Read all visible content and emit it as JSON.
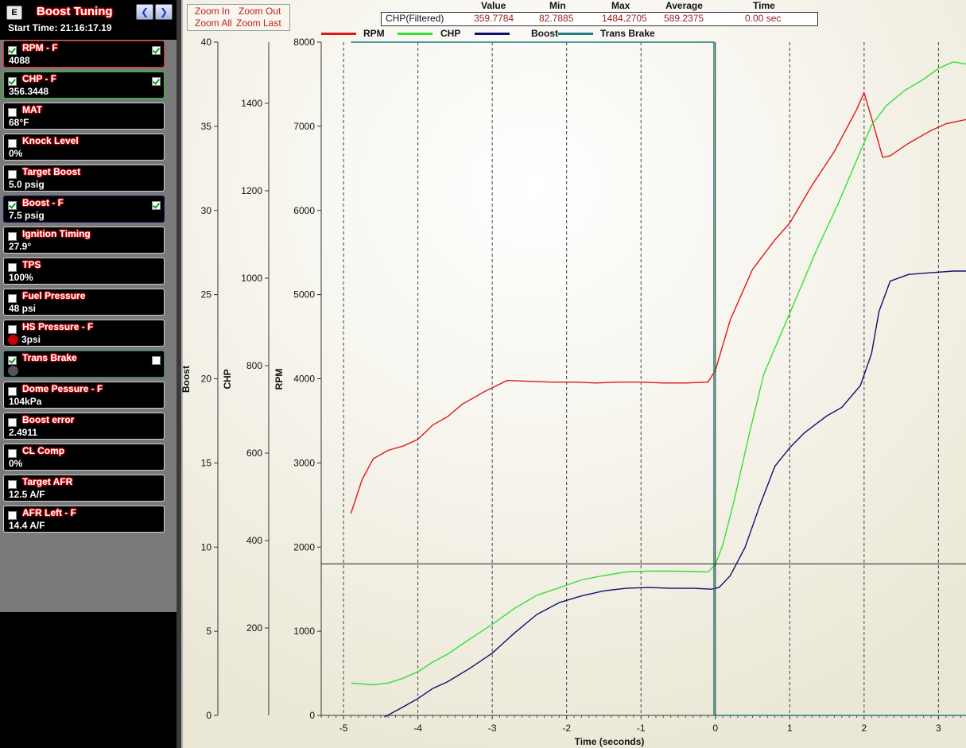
{
  "app": {
    "title": "Boost Tuning",
    "menu_label": "E",
    "start_time": "Start Time: 21:16:17.19",
    "nav_left": "❮",
    "nav_right": "❯"
  },
  "channels": [
    {
      "name": "RPM - F",
      "value": "4088",
      "checked": true,
      "right_check": true,
      "border": "#e02020"
    },
    {
      "name": "CHP - F",
      "value": "356.3448",
      "checked": true,
      "right_check": true,
      "border": "#20d020"
    },
    {
      "name": "MAT",
      "value": "68°F",
      "checked": false
    },
    {
      "name": "Knock Level",
      "value": "0%",
      "checked": false
    },
    {
      "name": "Target Boost",
      "value": "5.0 psig",
      "checked": false
    },
    {
      "name": "Boost - F",
      "value": "7.5 psig",
      "checked": true,
      "right_check": true,
      "border": "#10107a"
    },
    {
      "name": "Ignition Timing",
      "value": "27.9°",
      "checked": false
    },
    {
      "name": "TPS",
      "value": "100%",
      "checked": false
    },
    {
      "name": "Fuel Pressure",
      "value": "48 psi",
      "checked": false
    },
    {
      "name": "HS Pressure - F",
      "value": "3psi",
      "checked": false,
      "led": "#c00000"
    },
    {
      "name": "Trans Brake",
      "value": "",
      "checked": true,
      "right_check": false,
      "border": "#1a8080",
      "led": "#555555"
    },
    {
      "name": "Dome Pessure - F",
      "value": "104kPa",
      "checked": false
    },
    {
      "name": "Boost error",
      "value": "2.4911",
      "checked": false
    },
    {
      "name": "CL Comp",
      "value": "0%",
      "checked": false
    },
    {
      "name": "Target AFR",
      "value": "12.5 A/F",
      "checked": false
    },
    {
      "name": "AFR Left - F",
      "value": "14.4 A/F",
      "checked": false
    }
  ],
  "zoom": {
    "in": "Zoom In",
    "out": "Zoom Out",
    "all": "Zoom All",
    "last": "Zoom Last"
  },
  "stats": {
    "headers": {
      "value": "Value",
      "min": "Min",
      "max": "Max",
      "average": "Average",
      "time": "Time"
    },
    "channel": "CHP(Filtered)",
    "value": "359.7784",
    "min": "82.7885",
    "max": "1484.2705",
    "average": "589.2375",
    "time": "0.00 sec"
  },
  "chart_data": {
    "type": "line",
    "xlabel": "Time (seconds)",
    "xlim": [
      -5.3,
      3.37
    ],
    "x_ticks": [
      "-5",
      "-4",
      "-3",
      "-2",
      "-1",
      "0",
      "1",
      "2",
      "3"
    ],
    "grid": "vertical dashed at whole seconds",
    "legend": "top",
    "cursor": {
      "x": 0,
      "y_rpm": 1800
    },
    "axes": [
      {
        "label": "Boost",
        "ylim": [
          0,
          40
        ],
        "ticks": [
          "0",
          "5",
          "10",
          "15",
          "20",
          "25",
          "30",
          "35",
          "40"
        ]
      },
      {
        "label": "CHP",
        "ylim": [
          0,
          1540
        ],
        "ticks": [
          "200",
          "400",
          "600",
          "800",
          "1000",
          "1200",
          "1400"
        ]
      },
      {
        "label": "RPM",
        "ylim": [
          0,
          8000
        ],
        "ticks": [
          "0",
          "1000",
          "2000",
          "3000",
          "4000",
          "5000",
          "6000",
          "7000",
          "8000"
        ]
      }
    ],
    "series": [
      {
        "name": "RPM",
        "axis": "RPM",
        "color": "#e01818",
        "points": [
          [
            -4.9,
            2400
          ],
          [
            -4.75,
            2800
          ],
          [
            -4.6,
            3050
          ],
          [
            -4.4,
            3150
          ],
          [
            -4.2,
            3200
          ],
          [
            -4.0,
            3280
          ],
          [
            -3.8,
            3450
          ],
          [
            -3.6,
            3550
          ],
          [
            -3.4,
            3700
          ],
          [
            -3.1,
            3850
          ],
          [
            -2.8,
            3980
          ],
          [
            -2.5,
            3970
          ],
          [
            -2.2,
            3960
          ],
          [
            -1.9,
            3960
          ],
          [
            -1.6,
            3950
          ],
          [
            -1.3,
            3960
          ],
          [
            -1.0,
            3960
          ],
          [
            -0.7,
            3950
          ],
          [
            -0.4,
            3950
          ],
          [
            -0.1,
            3960
          ],
          [
            0,
            4100
          ],
          [
            0.2,
            4700
          ],
          [
            0.5,
            5300
          ],
          [
            0.8,
            5650
          ],
          [
            1.0,
            5850
          ],
          [
            1.3,
            6300
          ],
          [
            1.6,
            6700
          ],
          [
            1.9,
            7200
          ],
          [
            2.0,
            7400
          ],
          [
            2.1,
            7100
          ],
          [
            2.25,
            6630
          ],
          [
            2.35,
            6650
          ],
          [
            2.6,
            6800
          ],
          [
            2.9,
            6950
          ],
          [
            3.1,
            7030
          ],
          [
            3.37,
            7080
          ]
        ]
      },
      {
        "name": "CHP",
        "axis": "CHP",
        "color": "#35e035",
        "points": [
          [
            -4.9,
            74
          ],
          [
            -4.6,
            70
          ],
          [
            -4.4,
            74
          ],
          [
            -4.2,
            85
          ],
          [
            -4.0,
            100
          ],
          [
            -3.8,
            122
          ],
          [
            -3.6,
            140
          ],
          [
            -3.3,
            175
          ],
          [
            -3.0,
            208
          ],
          [
            -2.7,
            245
          ],
          [
            -2.4,
            275
          ],
          [
            -2.1,
            292
          ],
          [
            -1.8,
            310
          ],
          [
            -1.5,
            320
          ],
          [
            -1.2,
            328
          ],
          [
            -0.9,
            330
          ],
          [
            -0.6,
            330
          ],
          [
            -0.3,
            329
          ],
          [
            -0.1,
            328
          ],
          [
            0,
            345
          ],
          [
            0.1,
            390
          ],
          [
            0.25,
            490
          ],
          [
            0.45,
            640
          ],
          [
            0.65,
            780
          ],
          [
            0.85,
            860
          ],
          [
            1.1,
            960
          ],
          [
            1.35,
            1060
          ],
          [
            1.65,
            1170
          ],
          [
            1.9,
            1270
          ],
          [
            2.1,
            1350
          ],
          [
            2.3,
            1395
          ],
          [
            2.55,
            1430
          ],
          [
            2.8,
            1455
          ],
          [
            3.0,
            1480
          ],
          [
            3.2,
            1495
          ],
          [
            3.37,
            1490
          ]
        ]
      },
      {
        "name": "Boost",
        "axis": "Boost",
        "color": "#10106e",
        "points": [
          [
            -4.45,
            -0.1
          ],
          [
            -4.2,
            0.5
          ],
          [
            -4.0,
            1.0
          ],
          [
            -3.8,
            1.6
          ],
          [
            -3.6,
            2.0
          ],
          [
            -3.3,
            2.8
          ],
          [
            -3.0,
            3.7
          ],
          [
            -2.7,
            4.9
          ],
          [
            -2.4,
            6.0
          ],
          [
            -2.1,
            6.7
          ],
          [
            -1.8,
            7.1
          ],
          [
            -1.5,
            7.4
          ],
          [
            -1.2,
            7.55
          ],
          [
            -0.9,
            7.6
          ],
          [
            -0.6,
            7.55
          ],
          [
            -0.3,
            7.55
          ],
          [
            -0.05,
            7.5
          ],
          [
            0.05,
            7.6
          ],
          [
            0.2,
            8.3
          ],
          [
            0.4,
            10.0
          ],
          [
            0.6,
            12.5
          ],
          [
            0.8,
            14.8
          ],
          [
            1.0,
            15.9
          ],
          [
            1.2,
            16.8
          ],
          [
            1.5,
            17.8
          ],
          [
            1.7,
            18.3
          ],
          [
            1.95,
            19.6
          ],
          [
            2.1,
            21.5
          ],
          [
            2.2,
            24.0
          ],
          [
            2.35,
            25.8
          ],
          [
            2.6,
            26.2
          ],
          [
            2.9,
            26.3
          ],
          [
            3.2,
            26.4
          ],
          [
            3.37,
            26.4
          ]
        ]
      },
      {
        "name": "Trans Brake",
        "axis": "RPM",
        "color": "#1a8080",
        "points": [
          [
            -4.9,
            8000
          ],
          [
            -0.02,
            8000
          ],
          [
            -0.02,
            0
          ],
          [
            3.37,
            0
          ]
        ]
      }
    ]
  }
}
